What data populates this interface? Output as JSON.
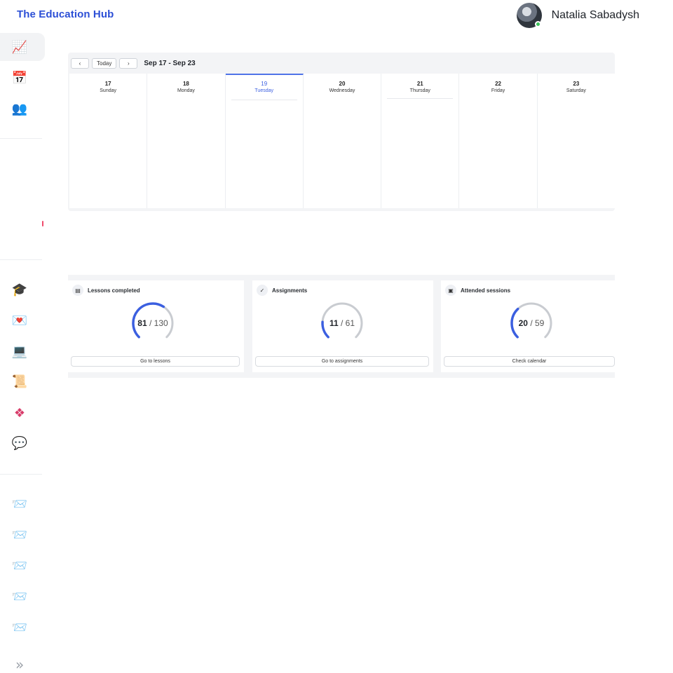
{
  "header": {
    "app_title": "The Education Hub",
    "user_name": "Natalia Sabadysh",
    "status_color": "#3cc25a",
    "accent_color": "#2c4fd6"
  },
  "sidebar": {
    "top_items": [
      {
        "icon": "chart-icon",
        "glyph": "📈",
        "active": true
      },
      {
        "icon": "calendar-icon",
        "glyph": "📅",
        "active": false
      },
      {
        "icon": "people-icon",
        "glyph": "👥",
        "active": false
      }
    ],
    "app_items": [
      {
        "icon": "graduation-cap-icon",
        "glyph": "🎓"
      },
      {
        "icon": "heart-letter-icon",
        "glyph": "💌"
      },
      {
        "icon": "laptop-icon",
        "glyph": "💻"
      },
      {
        "icon": "scroll-icon",
        "glyph": "📜"
      },
      {
        "icon": "slack-icon",
        "glyph": "❖"
      },
      {
        "icon": "chat-bubble-icon",
        "glyph": "💬"
      }
    ],
    "inbox_items": [
      {
        "icon": "inbox-icon",
        "glyph": "📨"
      },
      {
        "icon": "inbox-icon",
        "glyph": "📨"
      },
      {
        "icon": "inbox-icon",
        "glyph": "📨"
      },
      {
        "icon": "inbox-icon",
        "glyph": "📨"
      },
      {
        "icon": "inbox-icon",
        "glyph": "📨"
      }
    ],
    "expand_glyph": "»"
  },
  "calendar": {
    "prev_label": "‹",
    "today_label": "Today",
    "next_label": "›",
    "range_label": "Sep 17 - Sep 23",
    "days": [
      {
        "num": "17",
        "name": "Sunday",
        "current": false
      },
      {
        "num": "18",
        "name": "Monday",
        "current": false
      },
      {
        "num": "19",
        "name": "Tuesday",
        "current": true
      },
      {
        "num": "20",
        "name": "Wednesday",
        "current": false
      },
      {
        "num": "21",
        "name": "Thursday",
        "current": false
      },
      {
        "num": "22",
        "name": "Friday",
        "current": false
      },
      {
        "num": "23",
        "name": "Saturday",
        "current": false
      }
    ]
  },
  "stats": {
    "cards": [
      {
        "title": "Lessons completed",
        "icon": "lesson-icon",
        "glyph": "▤",
        "done": "81",
        "total": "130",
        "progress": 0.623,
        "button": "Go to lessons"
      },
      {
        "title": "Assignments",
        "icon": "check-circle-icon",
        "glyph": "✓",
        "done": "11",
        "total": "61",
        "progress": 0.18,
        "button": "Go to assignments"
      },
      {
        "title": "Attended sessions",
        "icon": "session-icon",
        "glyph": "▣",
        "done": "20",
        "total": "59",
        "progress": 0.339,
        "button": "Check calendar"
      }
    ],
    "progress_color": "#3b5fe0",
    "track_color": "#c9ccd1"
  }
}
